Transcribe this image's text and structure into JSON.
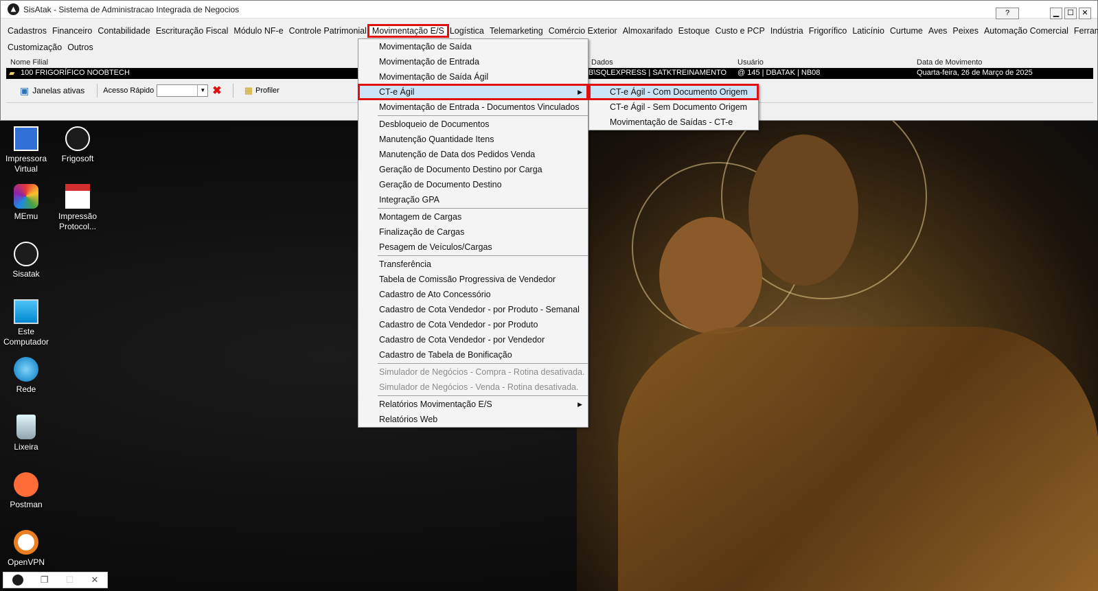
{
  "window": {
    "title": "SisAtak - Sistema de Administracao Integrada de Negocios",
    "help_label": "?",
    "minimize_label": "▁",
    "maximize_label": "☐",
    "close_label": "✕"
  },
  "menu_bar": {
    "row1": [
      "Cadastros",
      "Financeiro",
      "Contabilidade",
      "Escrituração Fiscal",
      "Módulo NF-e",
      "Controle Patrimonial",
      "Movimentação E/S",
      "Logística",
      "Telemarketing",
      "Comércio Exterior",
      "Almoxarifado",
      "Estoque",
      "Custo e PCP",
      "Indústria",
      "Frigorífico",
      "Laticínio",
      "Curtume",
      "Aves",
      "Peixes",
      "Automação Comercial",
      "Ferramentas"
    ],
    "row2": [
      "Customização",
      "Outros"
    ],
    "active": "Movimentação E/S"
  },
  "info": {
    "headers": {
      "filial": "Nome Filial",
      "dados": "Dados",
      "usuario": "Usuário",
      "data": "Data de Movimento"
    },
    "filial": "100 FRIGORÍFICO NOOBTECH",
    "dados": "B\\SQLEXPRESS | SATKTREINAMENTO",
    "usuario": "@ 145 | DBATAK | NB08",
    "data": "Quarta-feira, 26 de Março de 2025"
  },
  "toolbar": {
    "janelas_label": "Janelas ativas",
    "acesso_label": "Acesso Rápido",
    "acesso_value": "",
    "profiler_label": "Profiler"
  },
  "movimentacao_menu": {
    "group1": [
      "Movimentação de Saída",
      "Movimentação de Entrada",
      "Movimentação de Saída Ágil",
      "CT-e  Ágil",
      "Movimentação de Entrada - Documentos Vinculados"
    ],
    "group2": [
      "Desbloqueio de Documentos",
      "Manutenção Quantidade Itens",
      "Manutenção de Data dos Pedidos Venda",
      "Geração de Documento Destino por Carga",
      "Geração de Documento Destino",
      "Integração GPA"
    ],
    "group3": [
      "Montagem de Cargas",
      "Finalização de Cargas",
      "Pesagem de Veículos/Cargas"
    ],
    "group4": [
      "Transferência",
      "Tabela de Comissão Progressiva de Vendedor",
      "Cadastro de Ato Concessório",
      "Cadastro de Cota Vendedor - por Produto - Semanal",
      "Cadastro de Cota Vendedor - por Produto",
      "Cadastro de Cota Vendedor - por Vendedor",
      "Cadastro de Tabela de Bonificação"
    ],
    "group5": [
      "Simulador de Negócios - Compra - Rotina desativada.",
      "Simulador de Negócios - Venda - Rotina desativada."
    ],
    "group6": [
      "Relatórios Movimentação E/S",
      "Relatórios Web"
    ]
  },
  "cte_submenu": [
    "CT-e Ágil - Com Documento Origem",
    "CT-e Ágil - Sem Documento Origem",
    "Movimentação de Saídas - CT-e"
  ],
  "desktop_icons": [
    {
      "label": "Impressora Virtual",
      "icon": "printer-icon"
    },
    {
      "label": "Frigosoft",
      "icon": "frigosoft-icon"
    },
    {
      "label": "MEmu",
      "icon": "memu-icon"
    },
    {
      "label": "Impressão Protocol...",
      "icon": "pdf-icon"
    },
    {
      "label": "Sisatak",
      "icon": "sisatak-icon"
    },
    {
      "label": "Este Computador",
      "icon": "computer-icon"
    },
    {
      "label": "Rede",
      "icon": "network-icon"
    },
    {
      "label": "Lixeira",
      "icon": "recycle-bin-icon"
    },
    {
      "label": "Postman",
      "icon": "postman-icon"
    },
    {
      "label": "OpenVPN",
      "icon": "openvpn-icon"
    }
  ],
  "colors": {
    "highlight_border": "#e01010",
    "menu_highlight": "#cce4f7"
  }
}
